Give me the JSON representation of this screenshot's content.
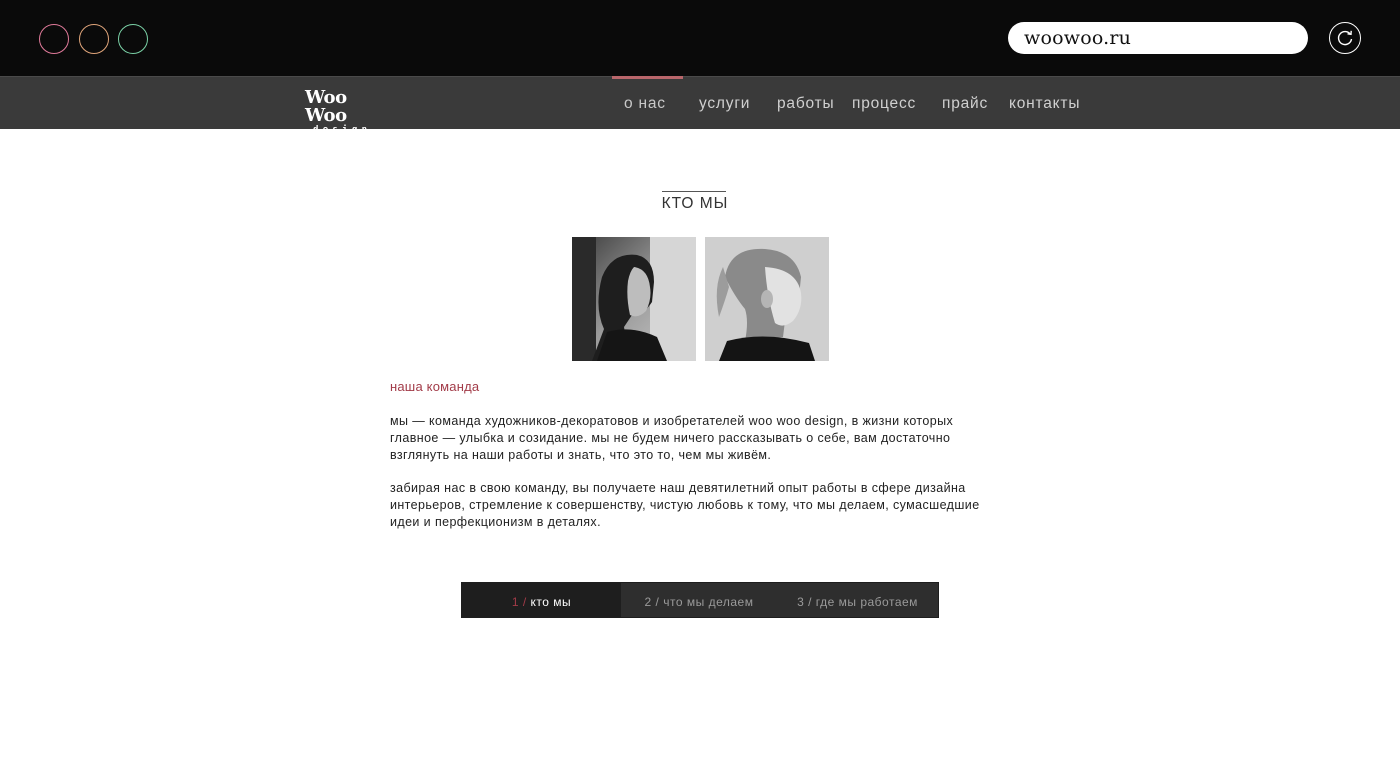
{
  "browser": {
    "window_buttons": [
      {
        "name": "close",
        "color": "#e07a9a"
      },
      {
        "name": "minimize",
        "color": "#e0a57a"
      },
      {
        "name": "maximize",
        "color": "#7ad1a6"
      }
    ],
    "url": "woowoo.ru",
    "reload_icon": "reload-icon"
  },
  "site": {
    "logo": {
      "main": "Woo Woo",
      "sub": "design"
    },
    "nav": [
      {
        "label": "о нас",
        "active": true
      },
      {
        "label": "услуги",
        "active": false
      },
      {
        "label": "работы",
        "active": false
      },
      {
        "label": "процесс",
        "active": false
      },
      {
        "label": "прайс",
        "active": false
      },
      {
        "label": "контакты",
        "active": false
      }
    ],
    "accent_color": "#b9666b"
  },
  "content": {
    "title": "кто мы",
    "subheading": "наша команда",
    "paragraph_1": "мы — команда художников-декоратовов и изобретателей woo woo design, в жизни которых главное — улыбка и созидание. мы не будем ничего рассказывать о себе, вам достаточно взглянуть на наши работы и знать, что это то, чем мы живём.",
    "paragraph_2": "забирая нас в свою команду, вы получаете наш девятилетний опыт работы в сфере дизайна интерьеров, стремление к совершенству, чистую любовь к тому, что мы делаем, сумасшедшие идеи и перфекционизм в деталях.",
    "tabs": [
      {
        "num": "1 /",
        "label": "кто мы",
        "active": true
      },
      {
        "num": "2 /",
        "label": "что мы делаем",
        "active": false
      },
      {
        "num": "3 /",
        "label": "где мы работаем",
        "active": false
      }
    ]
  }
}
